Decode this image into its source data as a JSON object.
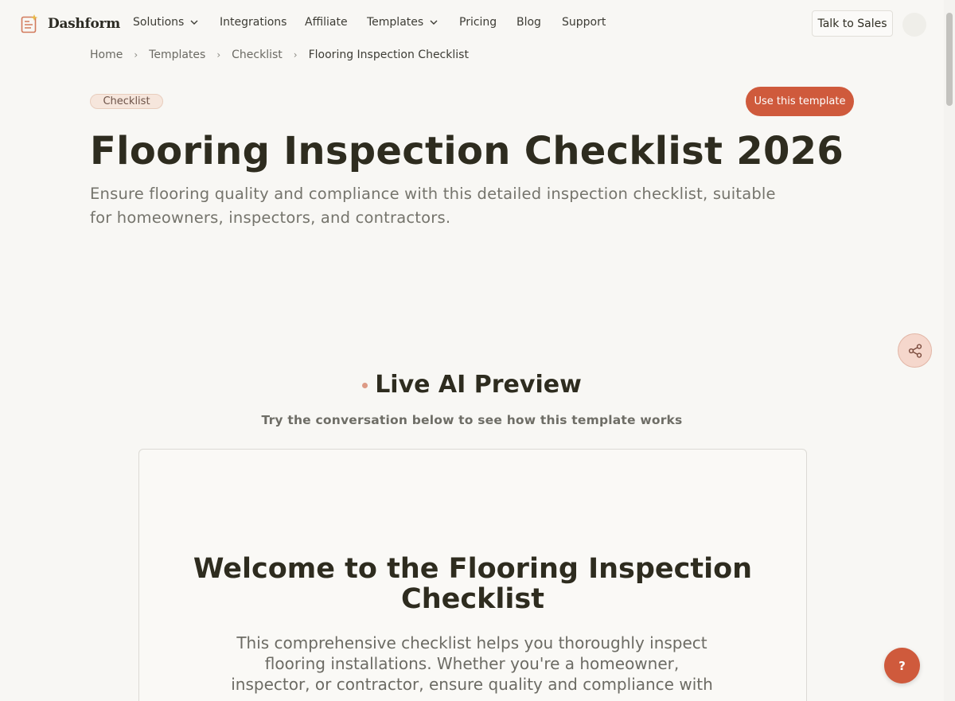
{
  "header": {
    "brand": "Dashform",
    "nav": [
      {
        "label": "Solutions",
        "has_dropdown": true
      },
      {
        "label": "Integrations",
        "has_dropdown": false
      },
      {
        "label": "Affiliate",
        "has_dropdown": false
      },
      {
        "label": "Templates",
        "has_dropdown": true
      },
      {
        "label": "Pricing",
        "has_dropdown": false
      },
      {
        "label": "Blog",
        "has_dropdown": false
      },
      {
        "label": "Support",
        "has_dropdown": false
      }
    ],
    "talk_to_sales": "Talk to Sales"
  },
  "breadcrumb": [
    "Home",
    "Templates",
    "Checklist",
    "Flooring Inspection Checklist"
  ],
  "hero": {
    "tag": "Checklist",
    "cta": "Use this template",
    "title": "Flooring Inspection Checklist 2026",
    "subtitle": "Ensure flooring quality and compliance with this detailed inspection checklist, suitable for homeowners, inspectors, and contractors."
  },
  "preview": {
    "heading": "Live AI Preview",
    "subheading": "Try the conversation below to see how this template works",
    "welcome_title": "Welcome to the Flooring Inspection Checklist",
    "welcome_text": "This comprehensive checklist helps you thoroughly inspect flooring installations. Whether you're a homeowner, inspector, or contractor, ensure quality and compliance with ease."
  },
  "help_button": "?",
  "icons": {
    "logo": "document-sparkle-icon",
    "share": "share-icon",
    "chevron": "chevron-down-icon"
  },
  "colors": {
    "accent": "#cf5a3c",
    "background": "#f8f7f4",
    "tag_bg": "#f6e6dc"
  }
}
